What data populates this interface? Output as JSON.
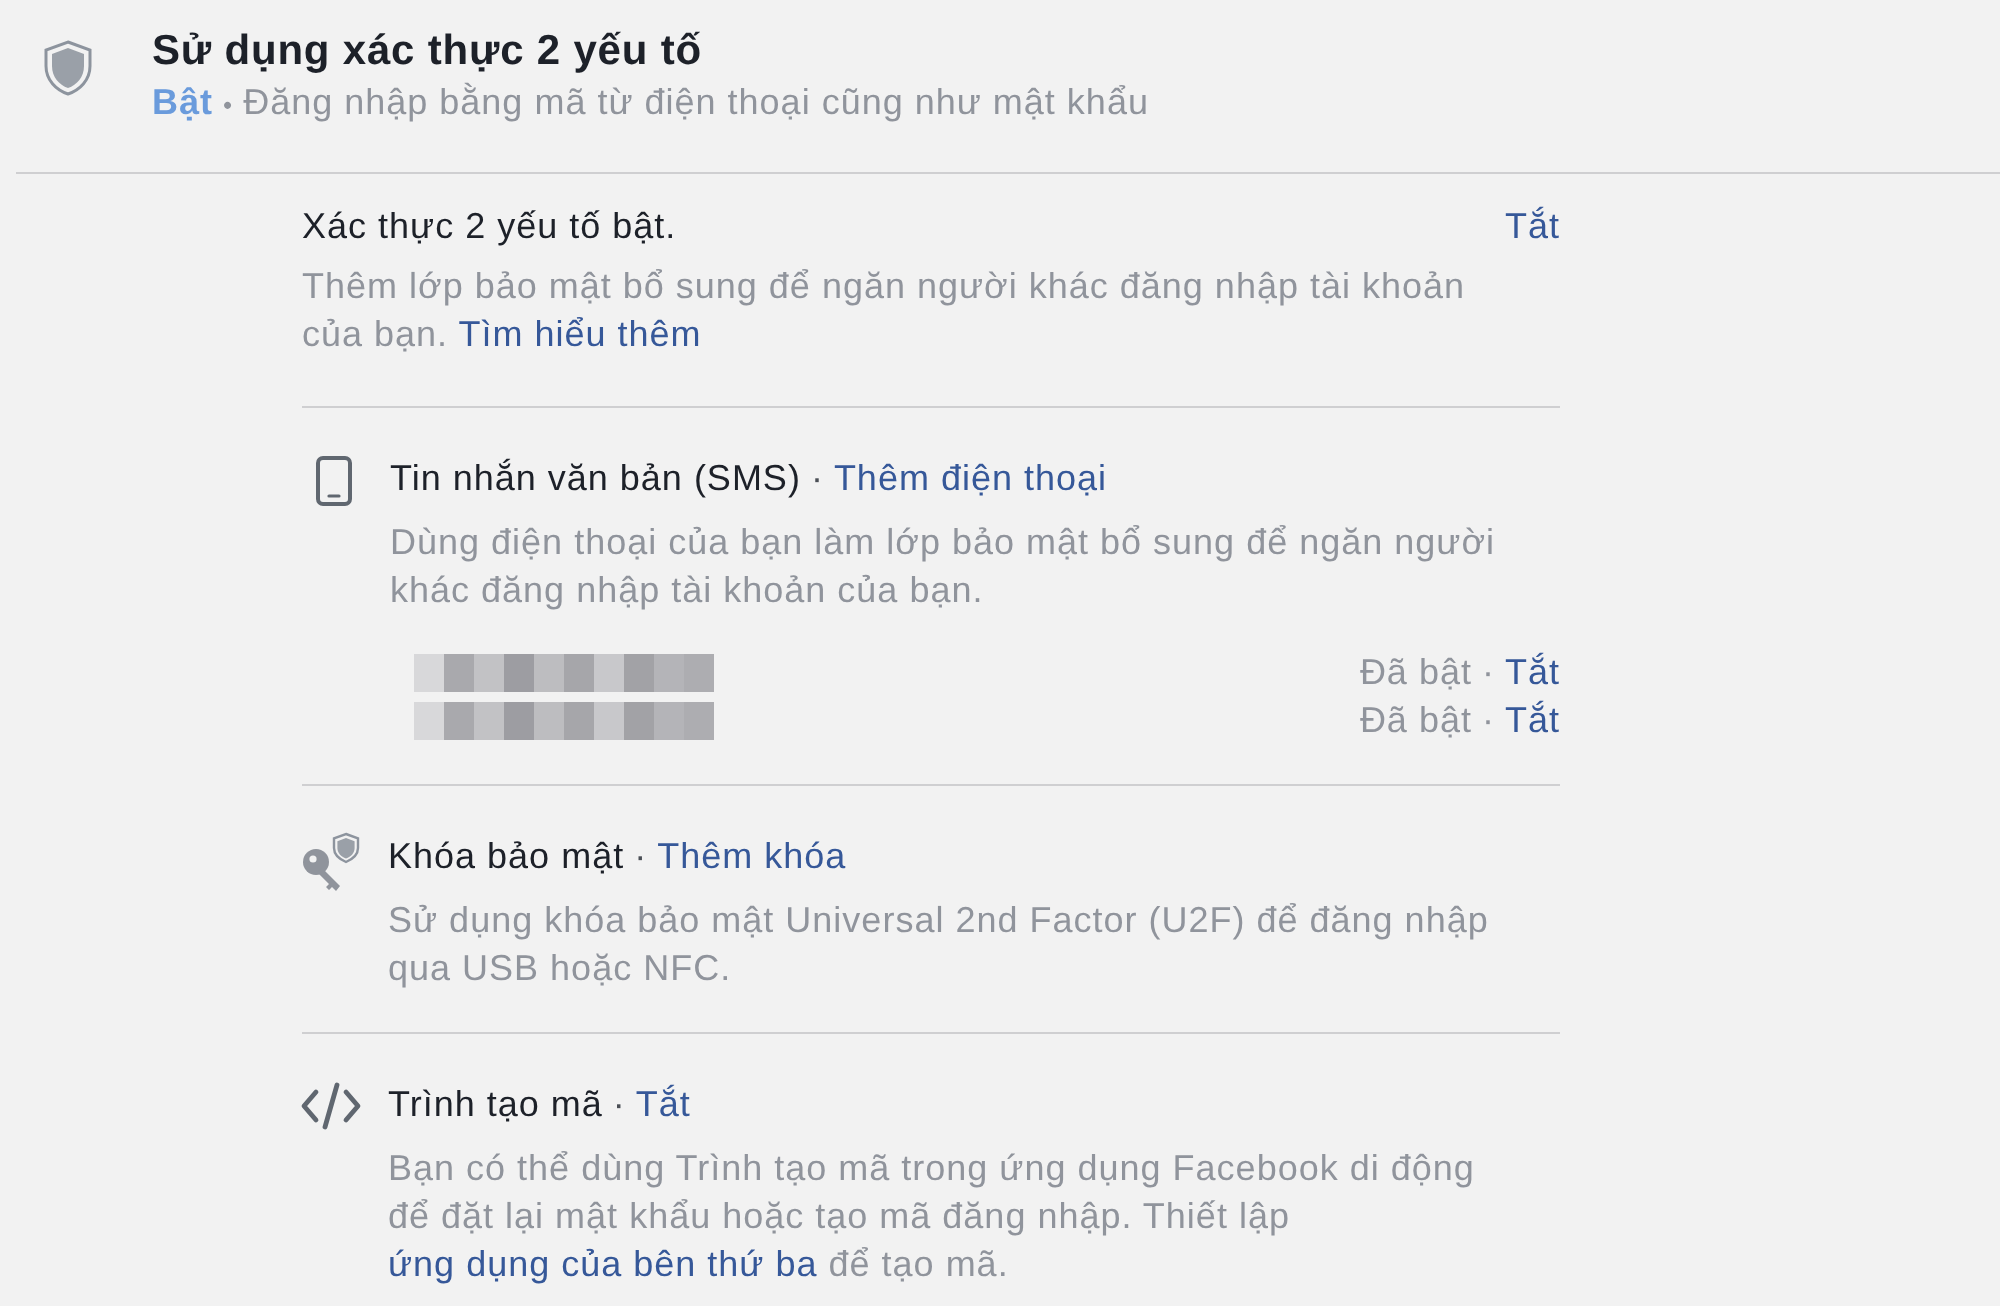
{
  "header": {
    "title": "Sử dụng xác thực 2 yếu tố",
    "status": "Bật",
    "on": true,
    "separator": "•",
    "summary": "Đăng nhập bằng mã từ điện thoại cũng như mật khẩu"
  },
  "intro": {
    "title": "Xác thực 2 yếu tố bật.",
    "action": "Tắt",
    "description": [
      {
        "kind": "text",
        "text": "Thêm lớp bảo mật bổ sung để ngăn người khác đăng nhập tài khoản của bạn. "
      },
      {
        "kind": "link",
        "text": "Tìm hiểu thêm"
      }
    ]
  },
  "methods": [
    {
      "kind": "sms",
      "title": "Tin nhắn văn bản (SMS)",
      "separator": "·",
      "action": "Thêm điện thoại",
      "description": [
        {
          "kind": "text",
          "text": "Dùng điện thoại của bạn làm lớp bảo mật bổ sung để ngăn người khác đăng nhập tài khoản của bạn."
        }
      ],
      "phones": [
        {
          "status": "Đã bật",
          "separator": "·",
          "action": "Tắt"
        },
        {
          "status": "Đã bật",
          "separator": "·",
          "action": "Tắt"
        }
      ]
    },
    {
      "kind": "security_key",
      "title": "Khóa bảo mật",
      "separator": "·",
      "action": "Thêm khóa",
      "description": [
        {
          "kind": "text",
          "text": "Sử dụng khóa bảo mật Universal 2nd Factor (U2F) để đăng nhập qua USB hoặc NFC."
        }
      ]
    },
    {
      "kind": "code_generator",
      "title": "Trình tạo mã",
      "separator": "·",
      "action": "Tắt",
      "description": [
        {
          "kind": "text",
          "text": "Bạn có thể dùng Trình tạo mã trong ứng dụng Facebook di động để đặt lại mật khẩu hoặc tạo mã đăng nhập. Thiết lập "
        },
        {
          "kind": "link",
          "text": "ứng dụng của bên thứ ba"
        },
        {
          "kind": "text",
          "text": " để tạo mã."
        }
      ]
    }
  ]
}
